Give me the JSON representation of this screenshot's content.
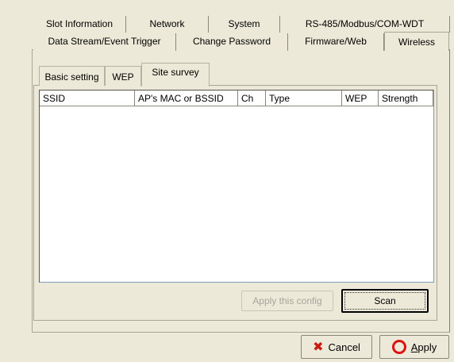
{
  "outer_tabs": {
    "row1": [
      "Slot Information",
      "Network",
      "System",
      "RS-485/Modbus/COM-WDT"
    ],
    "row2": [
      "Data Stream/Event Trigger",
      "Change Password",
      "Firmware/Web",
      "Wireless"
    ],
    "active": "Wireless"
  },
  "inner_tabs": {
    "items": [
      "Basic setting",
      "WEP",
      "Site survey"
    ],
    "active": "Site survey"
  },
  "site_survey": {
    "columns": [
      "SSID",
      "AP's MAC or BSSID",
      "Ch",
      "Type",
      "WEP",
      "Strength"
    ],
    "rows": []
  },
  "buttons": {
    "apply_config": "Apply this config",
    "scan": "Scan",
    "cancel": "Cancel",
    "apply": "Apply"
  },
  "icons": {
    "cancel": "x-icon",
    "apply": "circle-icon"
  },
  "colors": {
    "cancel_icon": "#c81a10",
    "apply_icon": "#dd1111"
  }
}
